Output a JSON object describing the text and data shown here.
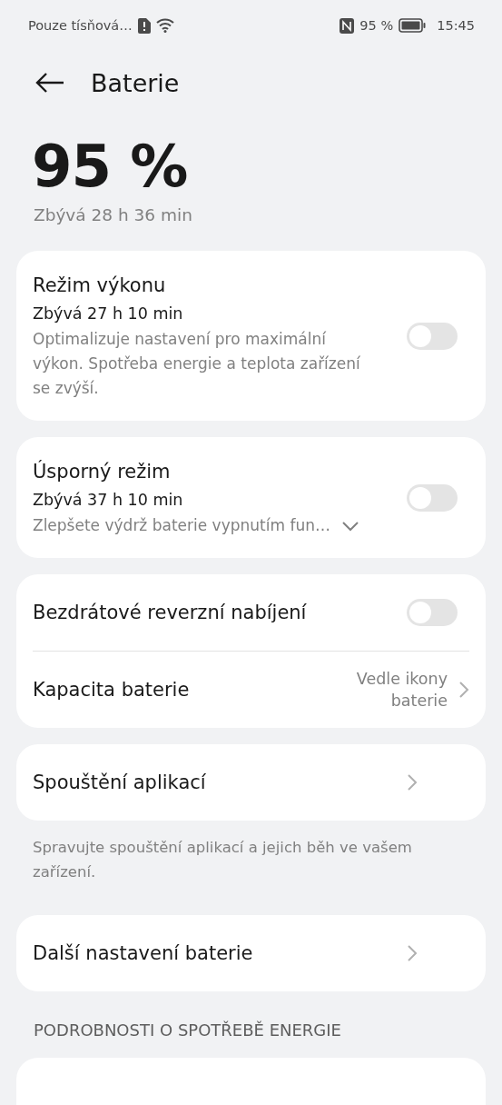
{
  "status_bar": {
    "carrier": "Pouze tísňová…",
    "battery": "95 %",
    "time": "15:45"
  },
  "header": {
    "title": "Baterie"
  },
  "summary": {
    "level_text": "95 %",
    "remaining": "Zbývá 28 h 36 min"
  },
  "cards": [
    {
      "rows": [
        {
          "kind": "toggle",
          "title": "Režim výkonu",
          "subtitle": "Zbývá 27 h 10 min",
          "description": "Optimalizuje nastavení pro maximální výkon. Spotřeba energie a teplota zařízení se zvýší.",
          "on": false
        }
      ]
    },
    {
      "rows": [
        {
          "kind": "toggle",
          "title": "Úsporný režim",
          "subtitle": "Zbývá 37 h 10 min",
          "description": "Zlepšete výdrž baterie vypnutím fun…",
          "expandable": true,
          "on": false
        }
      ]
    },
    {
      "rows": [
        {
          "kind": "toggle",
          "title": "Bezdrátové reverzní nabíjení",
          "on": false
        },
        {
          "kind": "link",
          "title": "Kapacita baterie",
          "value": "Vedle ikony baterie"
        }
      ]
    },
    {
      "rows": [
        {
          "kind": "link",
          "title": "Spouštění aplikací"
        }
      ],
      "note": "Spravujte spouštění aplikací a jejich běh ve vašem zařízení."
    },
    {
      "rows": [
        {
          "kind": "link",
          "title": "Další nastavení baterie"
        }
      ]
    }
  ],
  "section_header": "PODROBNOSTI O SPOTŘEBĚ ENERGIE"
}
